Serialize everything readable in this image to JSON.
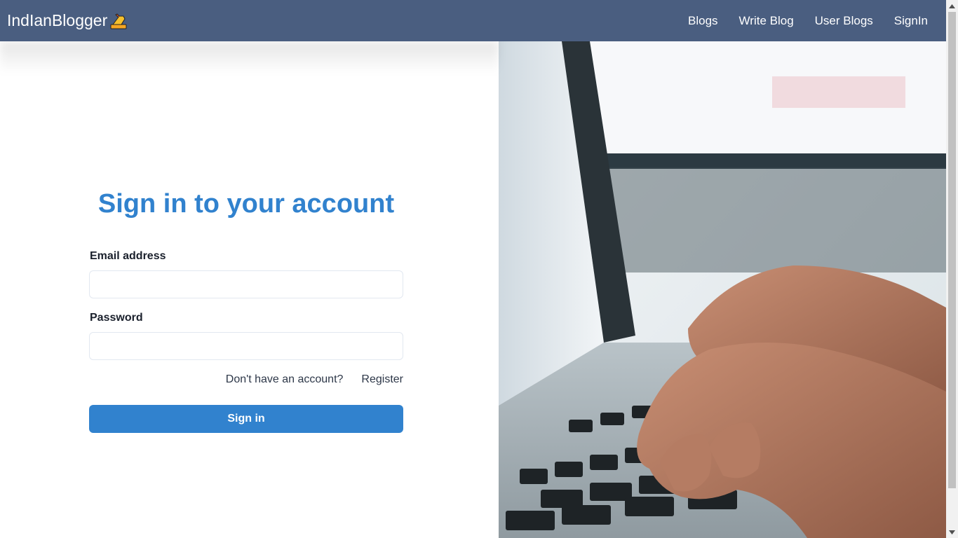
{
  "navbar": {
    "brand": "IndIanBlogger",
    "brand_icon": "writing-hand-icon",
    "links": [
      "Blogs",
      "Write Blog",
      "User Blogs",
      "SignIn"
    ]
  },
  "form": {
    "title": "Sign in to your account",
    "email_label": "Email address",
    "email_value": "",
    "password_label": "Password",
    "password_value": "",
    "no_account_text": "Don't have an account?",
    "register_link": "Register",
    "signin_button": "Sign in"
  },
  "image": {
    "subject": "hands-typing-on-laptop-photo"
  },
  "colors": {
    "navbar": "#4a5e80",
    "accent": "#3182ce"
  }
}
